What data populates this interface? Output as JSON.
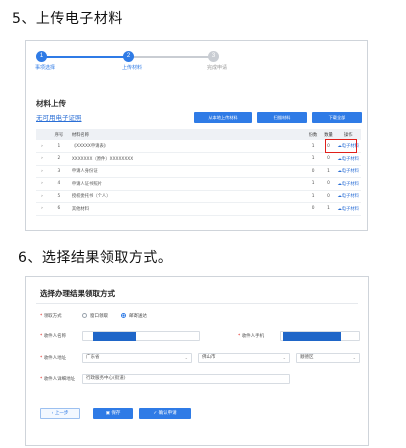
{
  "step5": {
    "heading": "5、上传电子材料"
  },
  "step6": {
    "heading": "6、选择结果领取方式。"
  },
  "progress": {
    "steps": [
      {
        "num": "1",
        "label": "事项选择"
      },
      {
        "num": "2",
        "label": "上传材料"
      },
      {
        "num": "3",
        "label": "完成申请"
      }
    ],
    "colors": {
      "done": "#2f7be6",
      "todo": "#c9cdd3"
    }
  },
  "materials": {
    "title": "材料上传",
    "subtitle": "无可用电子证照",
    "buttons": {
      "upload_local": "从本地上传材料",
      "scan": "扫描材料",
      "download": "下载全部"
    },
    "columns": [
      "序号",
      "材料名称",
      "份数",
      "数量",
      "操作"
    ],
    "rows": [
      {
        "idx": "1",
        "name": "《XXXXX申请表》",
        "copies": "1",
        "count": "0",
        "op": "电子材料"
      },
      {
        "idx": "2",
        "name": "XXXXXXX（原件）XXXXXXXX",
        "copies": "1",
        "count": "0",
        "op": "电子材料"
      },
      {
        "idx": "3",
        "name": "申请人身份证",
        "copies": "0",
        "count": "1",
        "op": "电子材料"
      },
      {
        "idx": "4",
        "name": "申请人证书照片",
        "copies": "1",
        "count": "0",
        "op": "电子材料"
      },
      {
        "idx": "5",
        "name": "授权委托书（个人）",
        "copies": "1",
        "count": "0",
        "op": "电子材料"
      },
      {
        "idx": "6",
        "name": "其他材料",
        "copies": "0",
        "count": "1",
        "op": "电子材料"
      }
    ]
  },
  "pickup": {
    "title": "选择办理结果领取方式",
    "method_label": "领取方式",
    "options": [
      {
        "label": "窗口领取",
        "selected": false
      },
      {
        "label": "邮寄送达",
        "selected": true
      }
    ],
    "recipient_label": "收件人名称",
    "phone_label": "收件人手机",
    "address_label": "收件人地址",
    "province": "广东省",
    "city": "佛山市",
    "district": "顺德区",
    "detail_label": "收件人详细地址",
    "detail_value": "行政服务中心(街道)",
    "buttons": {
      "prev": "上一步",
      "save": "保存",
      "submit": "确认申请"
    },
    "redact_color": "#1f66c8"
  }
}
